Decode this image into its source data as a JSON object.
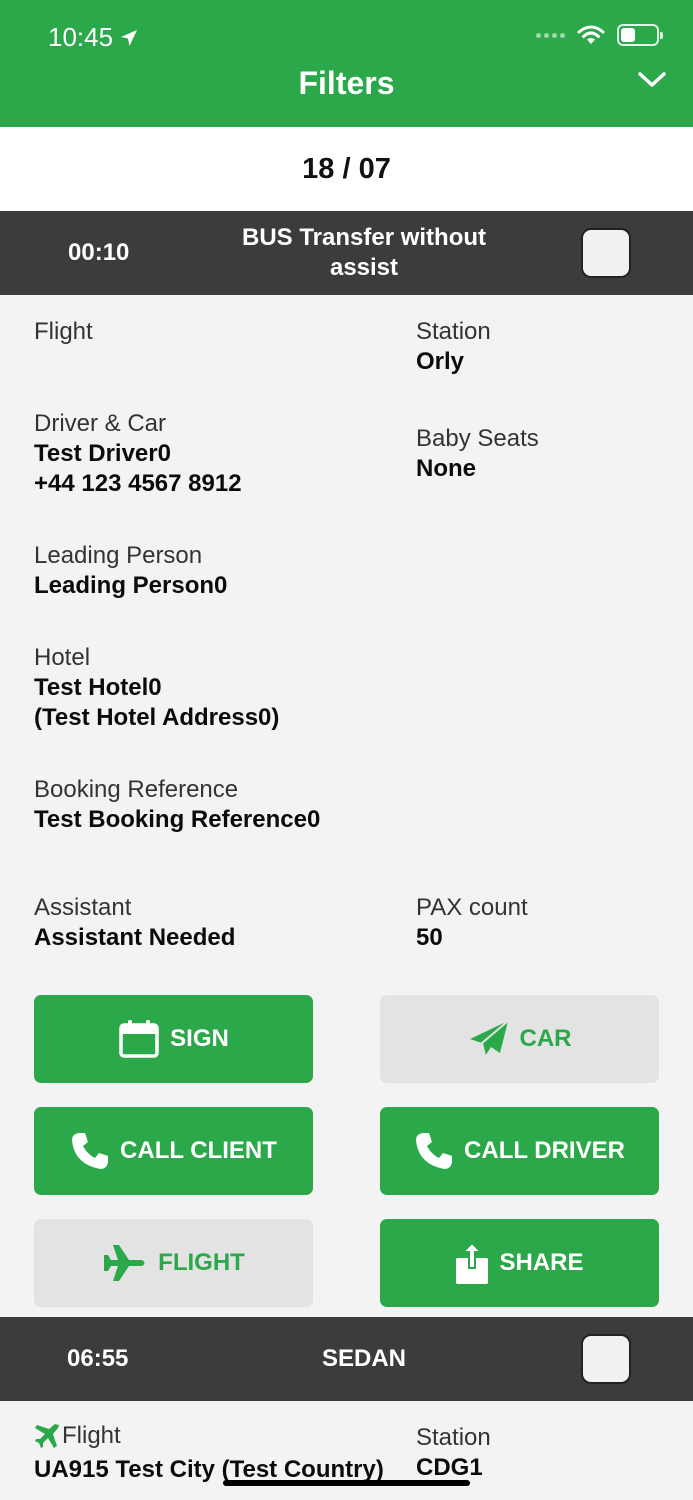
{
  "status_bar": {
    "time": "10:45"
  },
  "header": {
    "title": "Filters"
  },
  "date_bar": {
    "date": "18 / 07"
  },
  "transfers": [
    {
      "time": "00:10",
      "type": "BUS Transfer without assist",
      "flight": {
        "label": "Flight",
        "value": ""
      },
      "station": {
        "label": "Station",
        "value": "Orly"
      },
      "driver_car": {
        "label": "Driver & Car",
        "name": "Test Driver0",
        "phone": "+44 123 4567 8912"
      },
      "baby_seats": {
        "label": "Baby Seats",
        "value": "None"
      },
      "leading_person": {
        "label": "Leading Person",
        "value": "Leading Person0"
      },
      "hotel": {
        "label": "Hotel",
        "name": "Test Hotel0",
        "address": "(Test Hotel Address0)"
      },
      "booking_reference": {
        "label": "Booking Reference",
        "value": "Test Booking Reference0"
      },
      "assistant": {
        "label": "Assistant",
        "value": "Assistant Needed"
      },
      "pax_count": {
        "label": "PAX count",
        "value": "50"
      },
      "buttons": {
        "sign": "SIGN",
        "car": "CAR",
        "call_client": "CALL CLIENT",
        "call_driver": "CALL DRIVER",
        "flight": "FLIGHT",
        "share": "SHARE"
      }
    },
    {
      "time": "06:55",
      "type": "SEDAN",
      "flight": {
        "label": "Flight",
        "value": "UA915 Test City (Test Country)"
      },
      "station": {
        "label": "Station",
        "value": "CDG1"
      }
    }
  ],
  "colors": {
    "accent": "#2ba84a",
    "row_header": "#3c3c3c",
    "background": "#f3f3f3",
    "secondary_button": "#e3e3e3"
  }
}
